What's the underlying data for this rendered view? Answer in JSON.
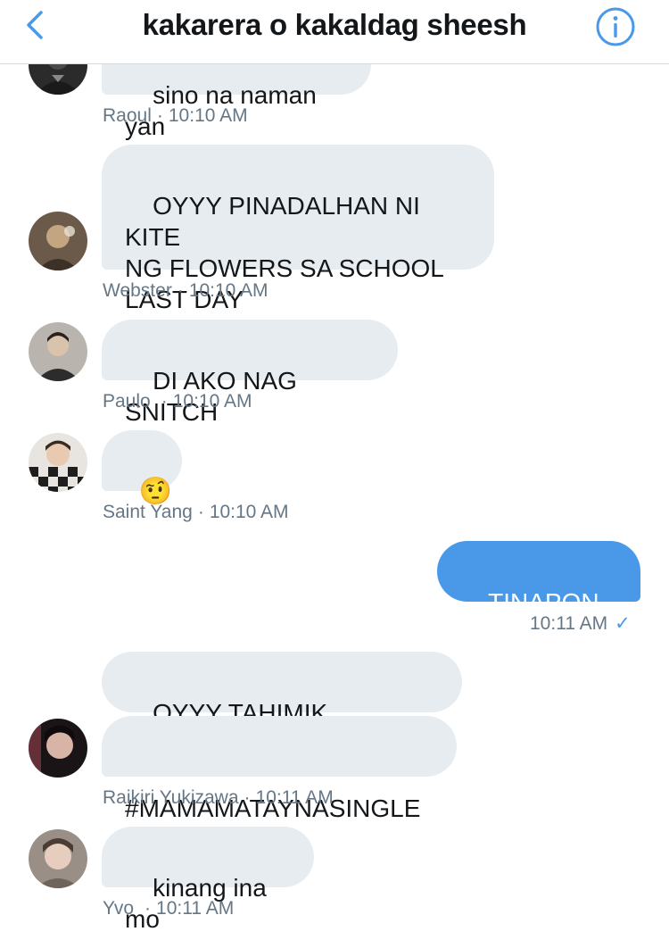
{
  "header": {
    "title": "kakarera o kakaldag sheesh"
  },
  "messages": [
    {
      "sender": "Raoul",
      "time": "10:10 AM",
      "text": "sino na naman yan"
    },
    {
      "sender": "Webster",
      "time": "10:10 AM",
      "text": "OYYY PINADALHAN NI KITE\nNG FLOWERS SA SCHOOL\nLAST DAY"
    },
    {
      "sender": "Paulo",
      "time": "10:10 AM",
      "text": "DI AKO NAG SNITCH"
    },
    {
      "sender": "Saint Yang",
      "time": "10:10 AM",
      "text": "🤨"
    },
    {
      "sender": "",
      "time": "10:11 AM",
      "text": "TINAPON KO",
      "outgoing": true,
      "status": "✓"
    },
    {
      "sender": "Raikiri Yukizawa",
      "time": "10:11 AM",
      "text": "OYYY TAHIMIK @yvoyoon"
    },
    {
      "sender": "Raikiri Yukizawa",
      "time": "10:11 AM",
      "text": "#MAMAMATAYNASINGLE"
    },
    {
      "sender": "Yvo",
      "time": "10:11 AM",
      "text": "kinang ina mo"
    }
  ],
  "meta_separator": "·",
  "colors": {
    "incoming_bubble": "#e6ecf0",
    "outgoing_bubble": "#4a99e9",
    "accent": "#4a99e9",
    "meta_text": "#657786"
  }
}
